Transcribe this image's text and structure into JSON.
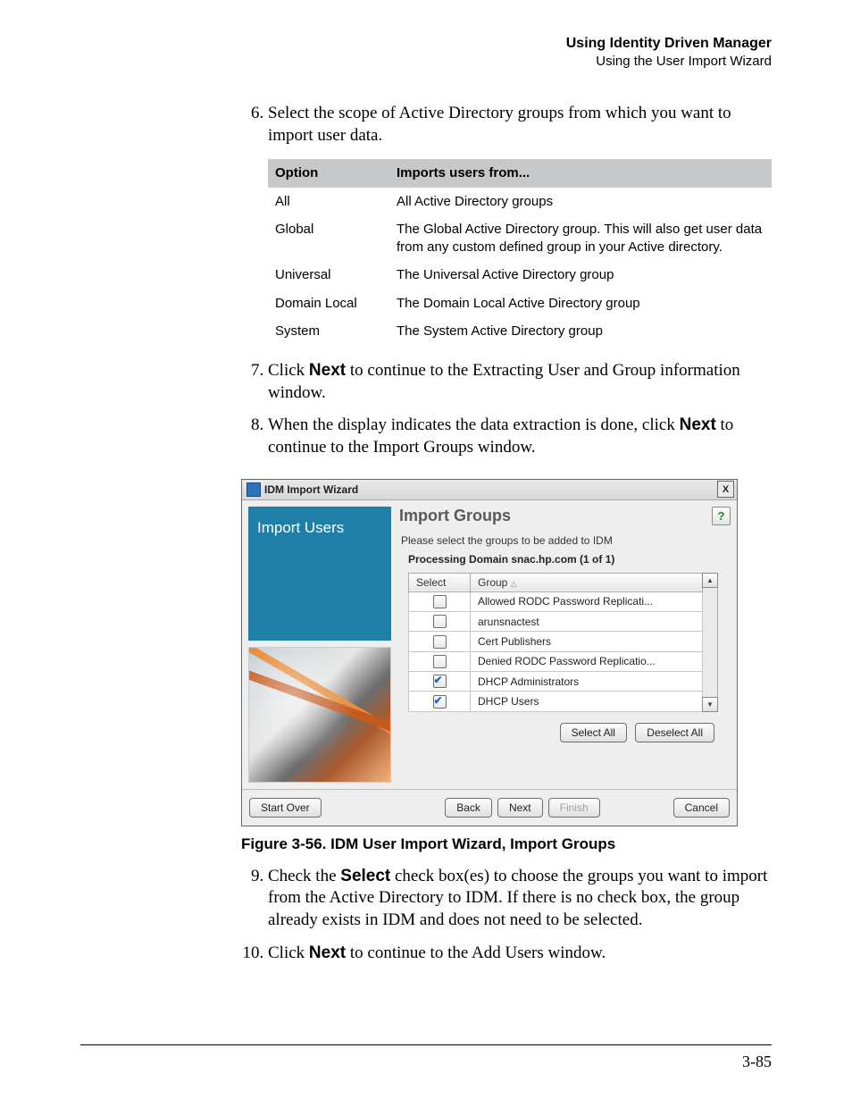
{
  "header": {
    "chapter": "Using Identity Driven Manager",
    "section": "Using the User Import Wizard"
  },
  "steps": {
    "s6": "Select the scope of Active Directory groups from which you want to import user data.",
    "table": {
      "h1": "Option",
      "h2": "Imports users from...",
      "rows": [
        {
          "opt": "All",
          "desc": "All Active Directory groups"
        },
        {
          "opt": "Global",
          "desc": "The Global Active Directory group. This will also get user data from any custom defined group in your Active directory."
        },
        {
          "opt": "Universal",
          "desc": "The Universal Active Directory group"
        },
        {
          "opt": "Domain Local",
          "desc": "The Domain Local Active Directory group"
        },
        {
          "opt": "System",
          "desc": "The System Active Directory group"
        }
      ]
    },
    "s7a": "Click ",
    "s7b": "Next",
    "s7c": " to continue to the Extracting User and Group information window.",
    "s8a": "When the display indicates the data extraction is done, click ",
    "s8b": "Next",
    "s8c": " to continue to the Import Groups window.",
    "s9a": "Check the ",
    "s9b": "Select",
    "s9c": " check box(es) to choose the groups you want to import from the Active Directory to IDM. If there is no check box, the group already exists in IDM and does not need to be selected.",
    "s10a": "Click ",
    "s10b": "Next",
    "s10c": " to continue to the Add Users window."
  },
  "wizard": {
    "title": "IDM Import Wizard",
    "sideTitle": "Import Users",
    "heading": "Import Groups",
    "instruction": "Please select the groups to be added to IDM",
    "processing": "Processing Domain snac.hp.com (1 of 1)",
    "cols": {
      "select": "Select",
      "group": "Group"
    },
    "rows": [
      {
        "checked": false,
        "name": "Allowed RODC Password Replicati..."
      },
      {
        "checked": false,
        "name": "arunsnactest"
      },
      {
        "checked": false,
        "name": "Cert Publishers"
      },
      {
        "checked": false,
        "name": "Denied RODC Password Replicatio..."
      },
      {
        "checked": true,
        "name": "DHCP Administrators"
      },
      {
        "checked": true,
        "name": "DHCP Users"
      }
    ],
    "btns": {
      "selectAll": "Select All",
      "deselectAll": "Deselect All",
      "startOver": "Start Over",
      "back": "Back",
      "next": "Next",
      "finish": "Finish",
      "cancel": "Cancel"
    },
    "help": "?",
    "close": "X"
  },
  "figureCaption": "Figure 3-56. IDM User Import Wizard, Import Groups",
  "pageNumber": "3-85"
}
